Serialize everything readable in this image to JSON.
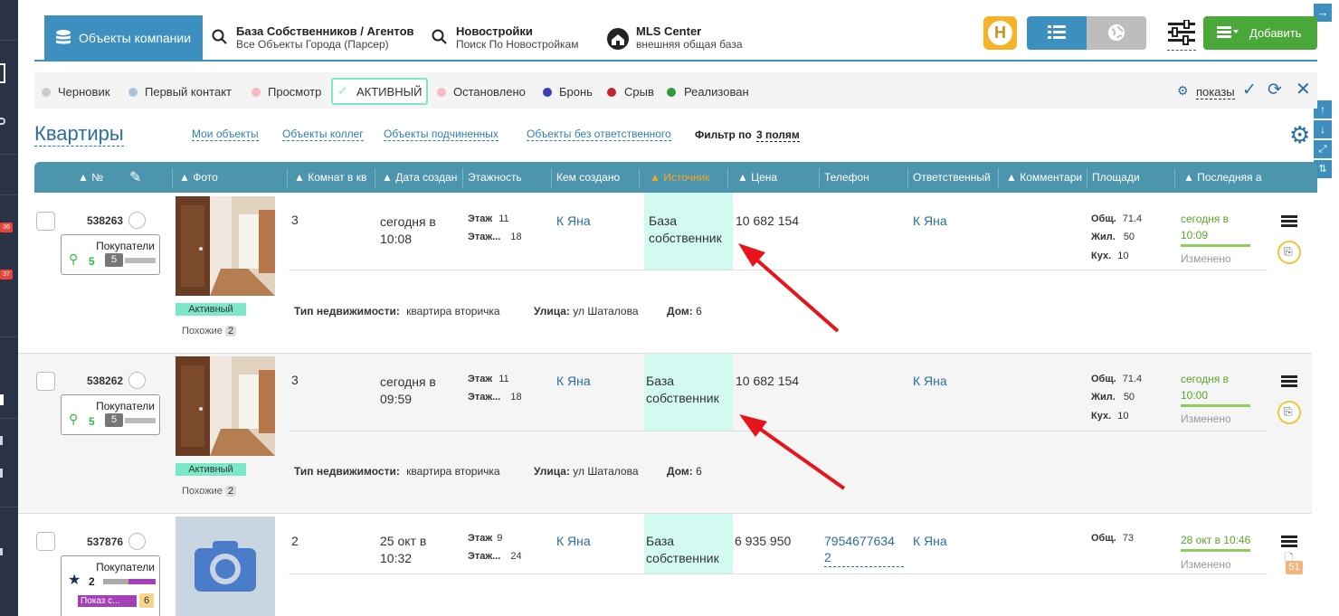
{
  "tabs": [
    {
      "t1": "Объекты компании",
      "t2": ""
    },
    {
      "t1": "База Собственников / Агентов",
      "t2": "Все Объекты Города (Парсер)"
    },
    {
      "t1": "Новостройки",
      "t2": "Поиск По Новостройкам"
    },
    {
      "t1": "MLS Center",
      "t2": "внешняя общая база"
    }
  ],
  "toolbar": {
    "add_label": "Добавить"
  },
  "statuses": [
    {
      "label": "Черновик",
      "color": "#cccccc"
    },
    {
      "label": "Первый контакт",
      "color": "#a9c4dc"
    },
    {
      "label": "Просмотр",
      "color": "#f7b9c4"
    },
    {
      "label": "АКТИВНЫЙ",
      "color": "#7ce8c7"
    },
    {
      "label": "Остановлено",
      "color": "#f7b9c4"
    },
    {
      "label": "Бронь",
      "color": "#3a3fb5"
    },
    {
      "label": "Срыв",
      "color": "#c0282f"
    },
    {
      "label": "Реализован",
      "color": "#2e9a3a"
    }
  ],
  "shows_label": "показы",
  "page_title": "Квартиры",
  "filter_links": [
    "Мои объекты",
    "Объекты коллег",
    "Объекты подчиненных",
    "Объекты без ответственного"
  ],
  "filter_by": {
    "label": "Фильтр по",
    "value": "3 полям"
  },
  "columns": [
    "№",
    "Фото",
    "Комнат в кв",
    "Дата создан",
    "Этажность",
    "Кем создано",
    "Источник",
    "Цена",
    "Телефон",
    "Ответственный",
    "Комментари",
    "Площади",
    "Последняя а"
  ],
  "rows": [
    {
      "id": "538263",
      "buyers_label": "Покупатели",
      "buyers_count": "5",
      "buyers_badge": "5",
      "status": "Активный",
      "similar_label": "Похожие",
      "similar_count": "2",
      "rooms": "3",
      "date1": "сегодня в",
      "date2": "10:08",
      "floor_label": "Этаж",
      "floor": "11",
      "floors_label": "Этаж...",
      "floors": "18",
      "created_by": "К Яна",
      "source1": "База",
      "source2": "собственник",
      "price": "10 682 154",
      "phone": "",
      "responsible": "К Яна",
      "area_total_label": "Общ.",
      "area_total": "71.4",
      "area_living_label": "Жил.",
      "area_living": "50",
      "area_kitchen_label": "Кух.",
      "area_kitchen": "10",
      "last1": "сегодня в",
      "last2": "10:09",
      "changed": "Изменено",
      "type_label": "Тип недвижимости:",
      "type_value": "квартира вторичка",
      "street_label": "Улица:",
      "street_value": "ул Шаталова",
      "house_label": "Дом:",
      "house_value": "6"
    },
    {
      "id": "538262",
      "buyers_label": "Покупатели",
      "buyers_count": "5",
      "buyers_badge": "5",
      "status": "Активный",
      "similar_label": "Похожие",
      "similar_count": "2",
      "rooms": "3",
      "date1": "сегодня в",
      "date2": "09:59",
      "floor_label": "Этаж",
      "floor": "11",
      "floors_label": "Этаж...",
      "floors": "18",
      "created_by": "К Яна",
      "source1": "База",
      "source2": "собственник",
      "price": "10 682 154",
      "phone": "",
      "responsible": "К Яна",
      "area_total_label": "Общ.",
      "area_total": "71.4",
      "area_living_label": "Жил.",
      "area_living": "50",
      "area_kitchen_label": "Кух.",
      "area_kitchen": "10",
      "last1": "сегодня в",
      "last2": "10:00",
      "changed": "Изменено",
      "type_label": "Тип недвижимости:",
      "type_value": "квартира вторичка",
      "street_label": "Улица:",
      "street_value": "ул Шаталова",
      "house_label": "Дом:",
      "house_value": "6"
    },
    {
      "id": "537876",
      "buyers_label": "Покупатели",
      "buyers_count": "2",
      "show_label": "Показ с...",
      "show_count": "6",
      "rooms": "2",
      "date1": "25 окт в",
      "date2": "10:32",
      "floor_label": "Этаж",
      "floor": "9",
      "floors_label": "Этаж...",
      "floors": "24",
      "created_by": "К Яна",
      "source1": "База",
      "source2": "собственник",
      "price": "6 935 950",
      "phone1": "7954677634",
      "phone2": "2",
      "responsible": "К Яна",
      "area_total_label": "Общ.",
      "area_total": "73",
      "last1": "28 окт в 10:46",
      "changed": "Изменено",
      "doc_badge": "51"
    }
  ],
  "sidebar_badges": [
    "36",
    "37"
  ],
  "colors": {
    "accent": "#3d8fbf",
    "header": "#4d94ad",
    "source_bg": "#d2faf0",
    "arrow": "#e8141b",
    "add_button": "#4aa83a"
  }
}
